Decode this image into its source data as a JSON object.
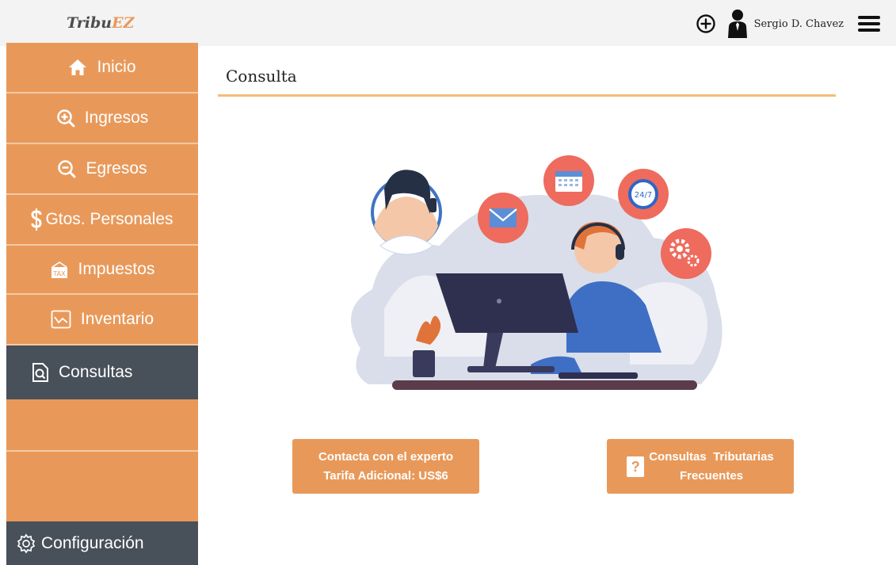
{
  "app": {
    "logo_main": "Tribu",
    "logo_accent": "EZ",
    "user_name": "Sergio D. Chavez"
  },
  "sidebar": {
    "items": [
      {
        "label": "Inicio",
        "icon": "home-icon"
      },
      {
        "label": "Ingresos",
        "icon": "zoom-in-icon"
      },
      {
        "label": "Egresos",
        "icon": "zoom-out-icon"
      },
      {
        "label": "Gtos. Personales",
        "icon": "dollar-icon"
      },
      {
        "label": "Impuestos",
        "icon": "tax-icon"
      },
      {
        "label": "Inventario",
        "icon": "chart-icon"
      },
      {
        "label": "Consultas",
        "icon": "document-search-icon",
        "active": true
      }
    ],
    "config_label": "Configuración",
    "tax_icon_text": "TAX"
  },
  "main": {
    "title": "Consulta",
    "expert_button": {
      "line1": "Contacta con el experto",
      "line2": "Tarifa Adicional: US$6"
    },
    "faq_button": {
      "line1": "Consultas  Tributarias",
      "line2": "Frecuentes",
      "icon_glyph": "?"
    },
    "illustration_badge": "24/7"
  },
  "colors": {
    "accent": "#e8995a",
    "sidebar_active": "#48505a",
    "title_rule": "#f1bd7a"
  }
}
